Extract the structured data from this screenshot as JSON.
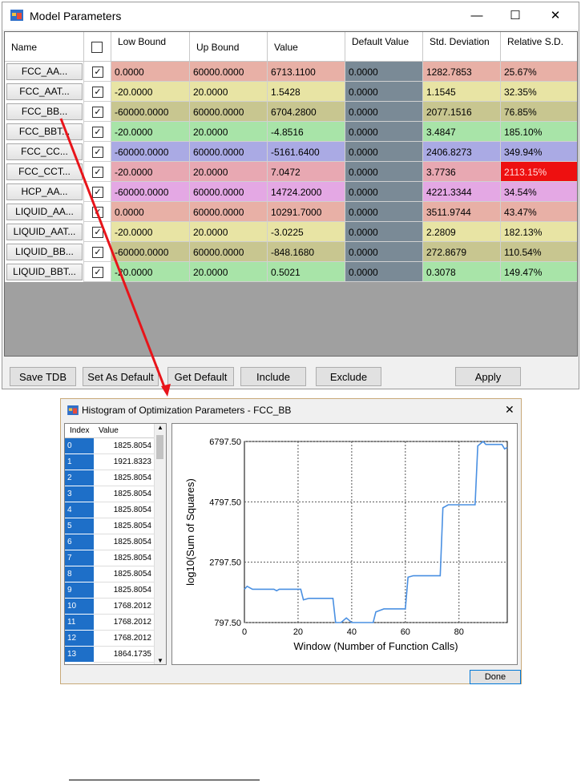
{
  "window1": {
    "title": "Model Parameters",
    "minimize": "—",
    "maximize": "☐",
    "close": "✕",
    "headers": [
      "Name",
      "",
      "Low Bound",
      "Up Bound",
      "Value",
      "Default Value",
      "Std. Deviation",
      "Relative S.D."
    ],
    "rows": [
      {
        "name": "FCC_AA...",
        "low": "0.0000",
        "up": "60000.0000",
        "value": "6713.1100",
        "def": "0.0000",
        "std": "1282.7853",
        "rel": "25.67%",
        "color": "#e8b0a6"
      },
      {
        "name": "FCC_AAT...",
        "low": "-20.0000",
        "up": "20.0000",
        "value": "1.5428",
        "def": "0.0000",
        "std": "1.1545",
        "rel": "32.35%",
        "color": "#e8e4a4"
      },
      {
        "name": "FCC_BB...",
        "low": "-60000.0000",
        "up": "60000.0000",
        "value": "6704.2800",
        "def": "0.0000",
        "std": "2077.1516",
        "rel": "76.85%",
        "color": "#c8c690"
      },
      {
        "name": "FCC_BBT...",
        "low": "-20.0000",
        "up": "20.0000",
        "value": "-4.8516",
        "def": "0.0000",
        "std": "3.4847",
        "rel": "185.10%",
        "color": "#a8e4a8"
      },
      {
        "name": "FCC_CC...",
        "low": "-60000.0000",
        "up": "60000.0000",
        "value": "-5161.6400",
        "def": "0.0000",
        "std": "2406.8273",
        "rel": "349.94%",
        "color": "#aaaae4"
      },
      {
        "name": "FCC_CCT...",
        "low": "-20.0000",
        "up": "20.0000",
        "value": "7.0472",
        "def": "0.0000",
        "std": "3.7736",
        "rel": "2113.15%",
        "color": "#e8a8b2",
        "relcolor": "#ee1010"
      },
      {
        "name": "HCP_AA...",
        "low": "-60000.0000",
        "up": "60000.0000",
        "value": "14724.2000",
        "def": "0.0000",
        "std": "4221.3344",
        "rel": "34.54%",
        "color": "#e4a8e4"
      },
      {
        "name": "LIQUID_AA...",
        "low": "0.0000",
        "up": "60000.0000",
        "value": "10291.7000",
        "def": "0.0000",
        "std": "3511.9744",
        "rel": "43.47%",
        "color": "#e8b0a6"
      },
      {
        "name": "LIQUID_AAT...",
        "low": "-20.0000",
        "up": "20.0000",
        "value": "-3.0225",
        "def": "0.0000",
        "std": "2.2809",
        "rel": "182.13%",
        "color": "#e8e4a4"
      },
      {
        "name": "LIQUID_BB...",
        "low": "-60000.0000",
        "up": "60000.0000",
        "value": "-848.1680",
        "def": "0.0000",
        "std": "272.8679",
        "rel": "110.54%",
        "color": "#c8c690"
      },
      {
        "name": "LIQUID_BBT...",
        "low": "-20.0000",
        "up": "20.0000",
        "value": "0.5021",
        "def": "0.0000",
        "std": "0.3078",
        "rel": "149.47%",
        "color": "#a8e4a8"
      }
    ],
    "buttons": {
      "save_tdb": "Save TDB",
      "set_default": "Set As Default",
      "get_default": "Get Default",
      "include": "Include",
      "exclude": "Exclude",
      "apply": "Apply"
    },
    "checkmark": "✓"
  },
  "window2": {
    "title": "Histogram of Optimization Parameters - FCC_BB",
    "close": "✕",
    "list_headers": {
      "index": "Index",
      "value": "Value"
    },
    "list_rows": [
      {
        "i": "0",
        "v": "1825.8054"
      },
      {
        "i": "1",
        "v": "1921.8323"
      },
      {
        "i": "2",
        "v": "1825.8054"
      },
      {
        "i": "3",
        "v": "1825.8054"
      },
      {
        "i": "4",
        "v": "1825.8054"
      },
      {
        "i": "5",
        "v": "1825.8054"
      },
      {
        "i": "6",
        "v": "1825.8054"
      },
      {
        "i": "7",
        "v": "1825.8054"
      },
      {
        "i": "8",
        "v": "1825.8054"
      },
      {
        "i": "9",
        "v": "1825.8054"
      },
      {
        "i": "10",
        "v": "1768.2012"
      },
      {
        "i": "11",
        "v": "1768.2012"
      },
      {
        "i": "12",
        "v": "1768.2012"
      },
      {
        "i": "13",
        "v": "1864.1735"
      }
    ],
    "done": "Done"
  },
  "chart_data": {
    "type": "line",
    "xlabel": "Window (Number of Function Calls)",
    "ylabel": "log10(Sum of Squares)",
    "xlim": [
      0,
      98
    ],
    "ylim": [
      797.5,
      6797.5
    ],
    "xticks": [
      0,
      20,
      40,
      60,
      80
    ],
    "yticks": [
      797.5,
      2797.5,
      4797.5,
      6797.5
    ],
    "ytick_labels": [
      "797.50",
      "2797.50",
      "4797.50",
      "6797.50"
    ],
    "line_color": "#4a90e2",
    "grid": "dashed",
    "points": [
      [
        0,
        1900
      ],
      [
        1,
        2000
      ],
      [
        3,
        1900
      ],
      [
        11,
        1900
      ],
      [
        12,
        1850
      ],
      [
        13,
        1900
      ],
      [
        21,
        1900
      ],
      [
        22,
        1550
      ],
      [
        24,
        1600
      ],
      [
        33,
        1600
      ],
      [
        34,
        797.5
      ],
      [
        36,
        797.5
      ],
      [
        38,
        950
      ],
      [
        40,
        797.5
      ],
      [
        48,
        797.5
      ],
      [
        49,
        1150
      ],
      [
        52,
        1250
      ],
      [
        60,
        1250
      ],
      [
        61,
        2300
      ],
      [
        63,
        2350
      ],
      [
        73,
        2350
      ],
      [
        74,
        4600
      ],
      [
        76,
        4700
      ],
      [
        86,
        4700
      ],
      [
        87,
        6650
      ],
      [
        89,
        6797.5
      ],
      [
        90,
        6700
      ],
      [
        96,
        6700
      ],
      [
        97,
        6550
      ],
      [
        98,
        6600
      ]
    ]
  }
}
